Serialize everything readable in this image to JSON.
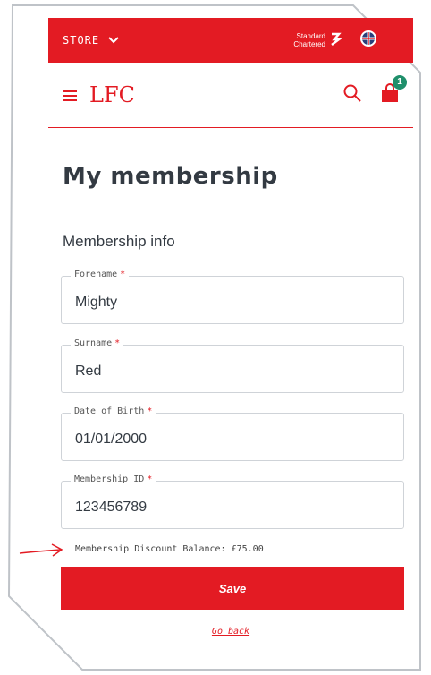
{
  "topbar": {
    "store_label": "STORE",
    "sponsor_line1": "Standard",
    "sponsor_line2": "Chartered"
  },
  "header": {
    "logo_text": "LFC",
    "cart_count": "1"
  },
  "page": {
    "title": "My membership",
    "section_title": "Membership info"
  },
  "fields": [
    {
      "label": "Forename",
      "required": "*",
      "value": "Mighty"
    },
    {
      "label": "Surname",
      "required": "*",
      "value": "Red"
    },
    {
      "label": "Date of Birth",
      "required": "*",
      "value": "01/01/2000"
    },
    {
      "label": "Membership ID",
      "required": "*",
      "value": "123456789"
    }
  ],
  "balance_text": "Membership Discount Balance: £75.00",
  "save_label": "Save",
  "back_label": "Go back",
  "colors": {
    "brand": "#e31b23",
    "badge": "#1f8f6b",
    "text": "#333a42"
  },
  "icons": [
    "chevron-down-icon",
    "standard-chartered-logo",
    "uk-flag-icon",
    "menu-icon",
    "search-icon",
    "shopping-bag-icon",
    "red-arrow-annotation"
  ]
}
